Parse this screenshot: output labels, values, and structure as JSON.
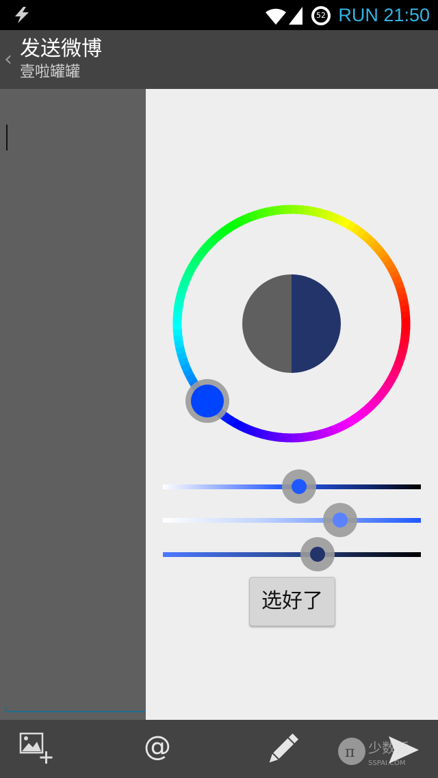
{
  "status_bar": {
    "battery": "52",
    "time": "RUN 21:50"
  },
  "action_bar": {
    "up_glyph": "‹",
    "title": "发送微博",
    "subtitle": "壹啦罐罐"
  },
  "color_picker": {
    "selected_color": "#22346a",
    "old_color": "#5f5f5f",
    "wheel_handle_color": "#0044ff",
    "saturation_slider_value": 0.54,
    "value_slider_value": 0.7,
    "opacity_slider_value": 0.6,
    "confirm_label": "选好了"
  },
  "bottom_bar": {
    "items": [
      {
        "name": "add-image",
        "icon": "image-plus-icon"
      },
      {
        "name": "mention",
        "icon": "at-icon",
        "glyph": "@"
      },
      {
        "name": "draw",
        "icon": "pencil-icon"
      },
      {
        "name": "send",
        "icon": "send-icon"
      }
    ],
    "watermark": {
      "brand": "少数派",
      "domain": "SSPAI.COM"
    }
  }
}
